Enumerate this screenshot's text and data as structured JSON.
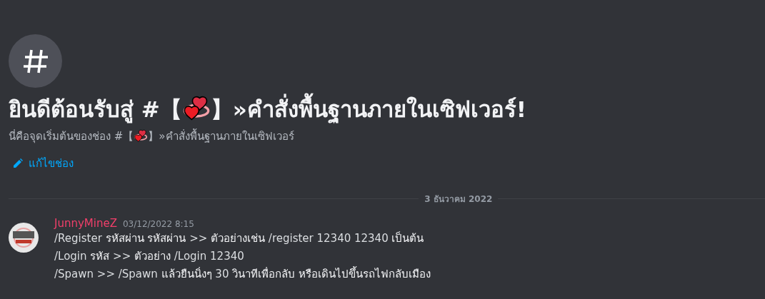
{
  "channel_header": {
    "title_before": "ยินดีต้อนรับสู่ #【",
    "title_after": "】»คำสั่งพื้นฐานภายในเซิฟเวอร์!",
    "subtitle_before": "นี่คือจุดเริ่มต้นของช่อง #【",
    "subtitle_after": "】»คำสั่งพื้นฐานภายในเซิฟเวอร์",
    "edit_link": "แก้ไขช่อง"
  },
  "date_divider": "3 ธันวาคม 2022",
  "messages": [
    {
      "author": "JunnyMineZ",
      "color": "#f23f6a",
      "timestamp": "03/12/2022 8:15",
      "lines": [
        "/Register **รหัสผ่าน รหัสผ่าน** >> **ตัวอย่างเช่น** /register 12340 12340 **เป็นต้น**",
        "/Login **รหัส** >> **ตัวอย่าง** /Login 12340",
        "/Spawn >> /Spawn **แล้วยืนนิ่งๆ** 30 **วินาทีเพื่อกลับ หรือเดินไปขึ้นรถไฟกลับเมือง**"
      ]
    }
  ]
}
